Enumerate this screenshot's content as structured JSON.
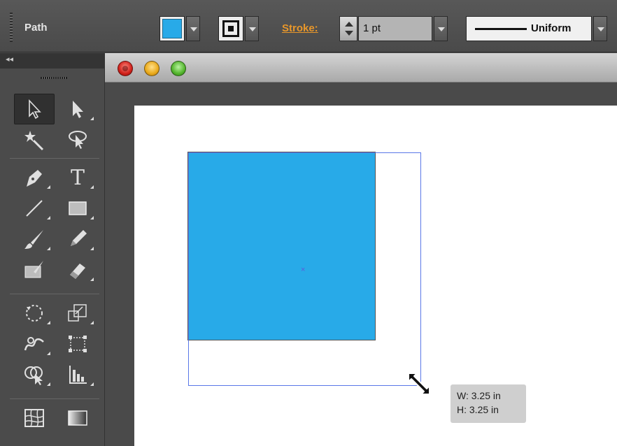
{
  "control_bar": {
    "selection_label": "Path",
    "fill_color": "#28aae8",
    "stroke_label": "Stroke:",
    "stroke_weight": "1 pt",
    "stroke_profile": "Uniform"
  },
  "tools_panel": {
    "collapse_icon": "◂◂",
    "tools": [
      [
        "selection-tool-icon",
        "direct-selection-tool-icon"
      ],
      [
        "magic-wand-tool-icon",
        "lasso-tool-icon"
      ],
      [
        "pen-tool-icon",
        "type-tool-icon"
      ],
      [
        "line-segment-tool-icon",
        "rectangle-tool-icon"
      ],
      [
        "paintbrush-tool-icon",
        "pencil-tool-icon"
      ],
      [
        "blob-brush-tool-icon",
        "eraser-tool-icon"
      ],
      [
        "rotate-tool-icon",
        "scale-tool-icon"
      ],
      [
        "warp-tool-icon",
        "free-transform-tool-icon"
      ],
      [
        "shape-builder-tool-icon",
        "graph-tool-icon"
      ],
      [
        "mesh-tool-icon",
        "gradient-tool-icon"
      ]
    ],
    "type_glyph": "T"
  },
  "document": {
    "square_color": "#28aae8",
    "center_mark": "×",
    "bbox_color": "#5a78e8"
  },
  "tooltip": {
    "width": "W: 3.25 in",
    "height": "H: 3.25 in"
  }
}
